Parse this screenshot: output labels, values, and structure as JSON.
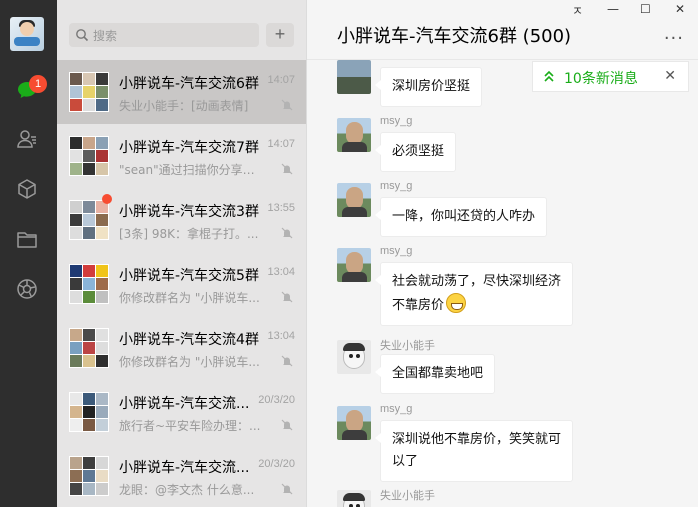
{
  "sidebar": {
    "chat_badge": "1",
    "icons": [
      "chat-icon",
      "contacts-icon",
      "favorites-icon",
      "files-icon",
      "moments-icon"
    ]
  },
  "search": {
    "placeholder": "搜索",
    "add_label": "+"
  },
  "chats": [
    {
      "name": "小胖说车-汽车交流6群",
      "time": "14:07",
      "preview": "失业小能手：[动画表情]",
      "muted": true,
      "unread_dot": false
    },
    {
      "name": "小胖说车-汽车交流7群",
      "time": "14:07",
      "preview": "\"sean\"通过扫描你分享的...",
      "muted": true,
      "unread_dot": false
    },
    {
      "name": "小胖说车-汽车交流3群",
      "time": "13:55",
      "preview": "[3条] 98K：拿棍子打。...",
      "muted": true,
      "unread_dot": true
    },
    {
      "name": "小胖说车-汽车交流5群",
      "time": "13:04",
      "preview": "你修改群名为 \"小胖说车...",
      "muted": true,
      "unread_dot": false
    },
    {
      "name": "小胖说车-汽车交流4群",
      "time": "13:04",
      "preview": "你修改群名为 \"小胖说车...",
      "muted": true,
      "unread_dot": false
    },
    {
      "name": "小胖说车-汽车交流...",
      "time": "20/3/20",
      "preview": "旅行者~平安车险办理：...",
      "muted": true,
      "unread_dot": false
    },
    {
      "name": "小胖说车-汽车交流...",
      "time": "20/3/20",
      "preview": "龙眼：@李文杰 什么意...",
      "muted": true,
      "unread_dot": false
    }
  ],
  "window": {
    "pin": "ㅈ",
    "minimize": "—",
    "maximize": "☐",
    "close": "✕"
  },
  "chat": {
    "title": "小胖说车-汽车交流6群 (500)",
    "more": "···",
    "new_messages": "10条新消息",
    "new_messages_close": "✕",
    "messages": [
      {
        "sender": "",
        "text": "深圳房价坚挺"
      },
      {
        "sender": "msy_g",
        "text": "必须坚挺"
      },
      {
        "sender": "msy_g",
        "text": "一降，你叫还贷的人咋办"
      },
      {
        "sender": "msy_g",
        "line1": "社会就动荡了，尽快深圳经济",
        "line2": "不靠房价"
      },
      {
        "sender": "失业小能手",
        "text": "全国都靠卖地吧"
      },
      {
        "sender": "msy_g",
        "line1": "深圳说他不靠房价，笑笑就可",
        "line2": "以了"
      },
      {
        "sender": "失业小能手",
        "text": ""
      }
    ]
  },
  "colors": {
    "accent": "#1aad19",
    "badge": "#f74c31",
    "rail": "#2e2e2e"
  }
}
